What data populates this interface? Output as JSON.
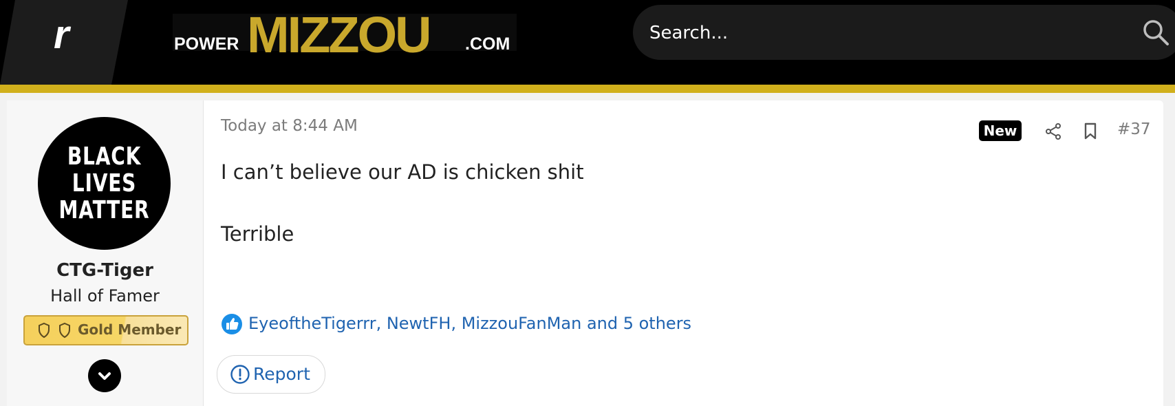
{
  "header": {
    "app_badge_letter": "r",
    "logo": {
      "part1": "POWER",
      "part2": "MIZZOU",
      "part3": ".COM"
    },
    "search_placeholder": "Search..."
  },
  "user": {
    "avatar_text": [
      "BLACK",
      "LIVES",
      "MATTER"
    ],
    "name": "CTG-Tiger",
    "title": "Hall of Famer",
    "badge": "Gold Member"
  },
  "post": {
    "time": "Today at 8:44 AM",
    "new_label": "New",
    "number": "#37",
    "body_line1": "I can’t believe our AD is chicken shit",
    "body_line2": "Terrible",
    "reactions": "EyeoftheTigerrr, NewtFH, MizzouFanMan and 5 others",
    "report_label": "Report"
  },
  "colors": {
    "header_bg": "#000000",
    "gold": "#d1b01c",
    "logo_gold": "#c9a82c",
    "link_blue": "#1f63b0",
    "like_blue": "#1a8ee6"
  },
  "icons": [
    "search-icon",
    "share-icon",
    "bookmark-icon",
    "like-icon",
    "report-icon",
    "chevron-down-icon",
    "shield-icon"
  ]
}
